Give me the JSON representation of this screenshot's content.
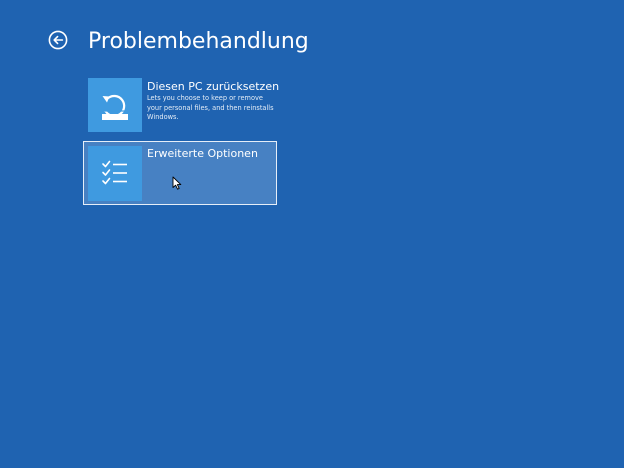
{
  "header": {
    "title": "Problembehandlung",
    "back_icon": "back-arrow-circle-icon"
  },
  "options": [
    {
      "title": "Diesen PC zurücksetzen",
      "description": "Lets you choose to keep or remove your personal files, and then reinstalls Windows.",
      "icon": "reset-pc-icon"
    },
    {
      "title": "Erweiterte Optionen",
      "description": "",
      "icon": "checklist-icon"
    }
  ],
  "colors": {
    "background": "#1f63b1",
    "tile": "#3f9ae0",
    "selected": "#4781c3",
    "text": "#ffffff"
  }
}
